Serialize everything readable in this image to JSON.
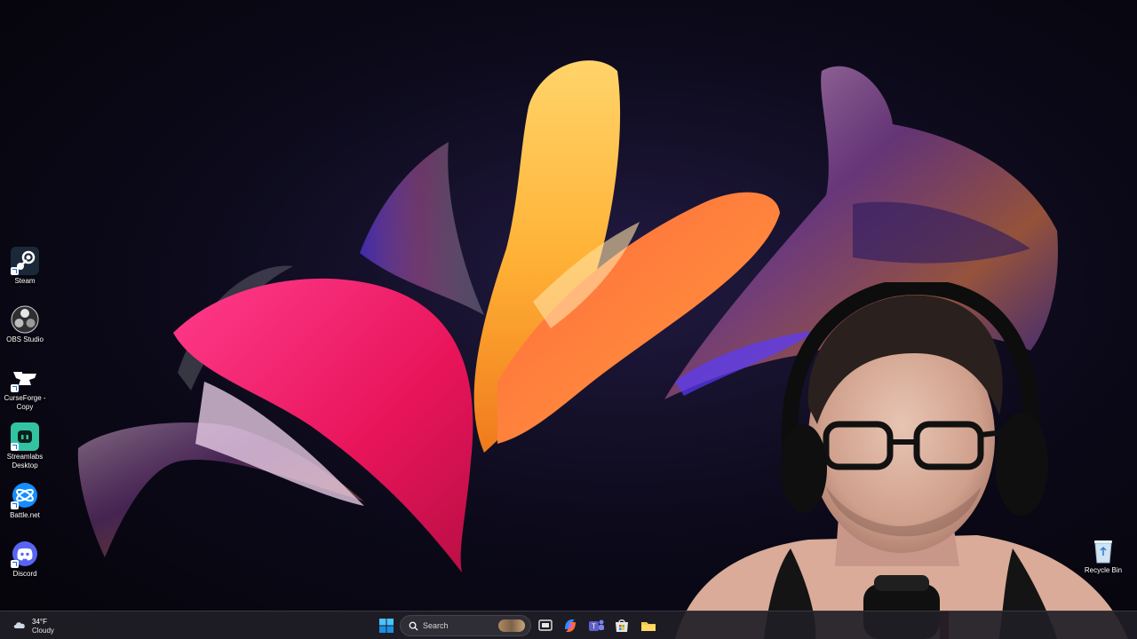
{
  "desktop": {
    "icons": [
      {
        "label": "Steam",
        "icon": "steam-icon",
        "color": "#1b2838"
      },
      {
        "label": "OBS Studio",
        "icon": "obs-icon",
        "color": "#302e31"
      },
      {
        "label": "CurseForge -\nCopy",
        "icon": "curseforge-icon",
        "color": "#1b1b1b"
      },
      {
        "label": "Streamlabs\nDesktop",
        "icon": "streamlabs-icon",
        "color": "#31c3a2"
      },
      {
        "label": "Battle.net",
        "icon": "battlenet-icon",
        "color": "#148eff"
      },
      {
        "label": "Discord",
        "icon": "discord-icon",
        "color": "#5865f2"
      }
    ],
    "recycle_bin": {
      "label": "Recycle Bin",
      "icon": "recycle-bin-icon"
    }
  },
  "taskbar": {
    "weather": {
      "temp": "34°F",
      "condition": "Cloudy",
      "icon": "cloud-icon"
    },
    "start_icon": "windows-start-icon",
    "search": {
      "label": "Search",
      "icon": "search-icon"
    },
    "pinned": [
      {
        "name": "task-view-icon"
      },
      {
        "name": "copilot-icon"
      },
      {
        "name": "teams-icon"
      },
      {
        "name": "store-icon"
      },
      {
        "name": "file-explorer-icon"
      }
    ]
  },
  "colors": {
    "accent": "#0078d4",
    "taskbar": "#201e26"
  }
}
